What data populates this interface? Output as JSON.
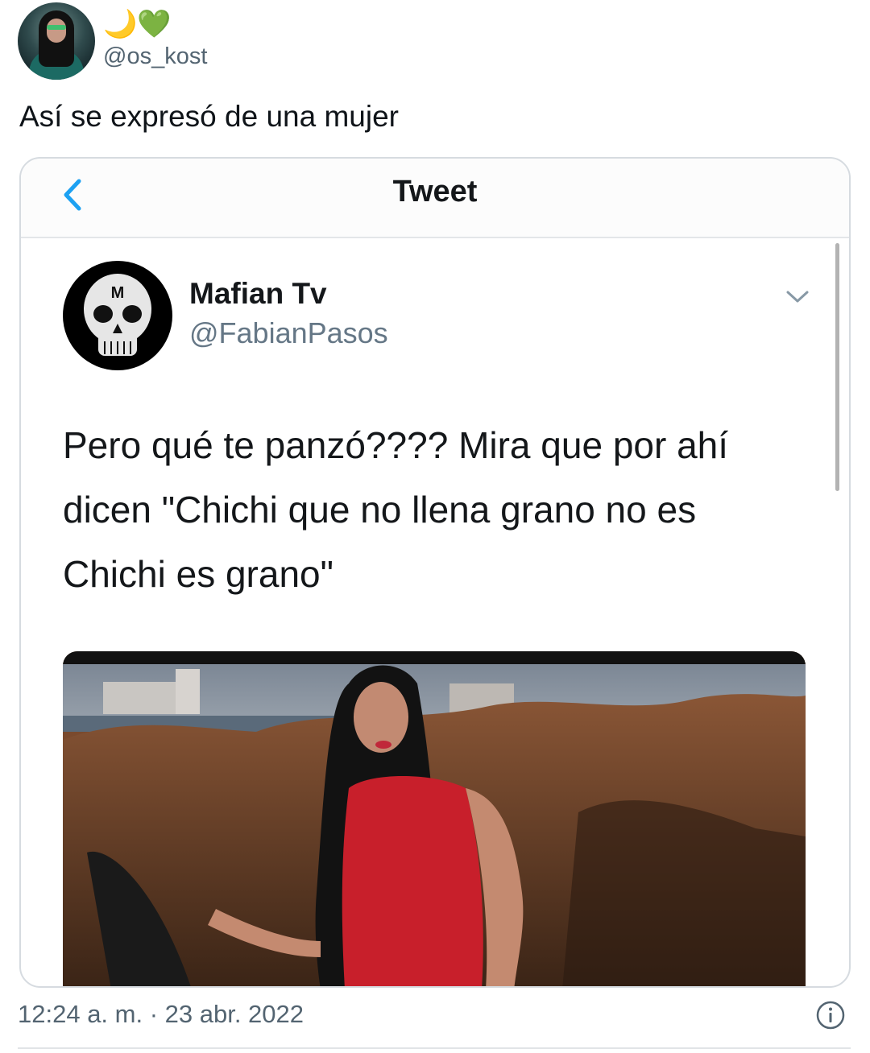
{
  "author": {
    "emojis": [
      "🌙",
      "💚"
    ],
    "handle": "@os_kost"
  },
  "tweet": {
    "text": "Así se expresó de una mujer",
    "timestamp": "12:24 a. m. · 23 abr. 2022"
  },
  "embedded_screenshot": {
    "header_title": "Tweet",
    "name": "Mafian Tv",
    "handle": "@FabianPasos",
    "body": "Pero qué te panzó???? Mira que por ahí dicen \"Chichi que no llena grano no es Chichi es grano\"",
    "avatar_letter": "M"
  },
  "icons": {
    "back": "chevron-left-icon",
    "more": "chevron-down-icon",
    "info": "info-icon"
  },
  "colors": {
    "accent": "#1da1f2",
    "secondary_text": "#536471"
  }
}
